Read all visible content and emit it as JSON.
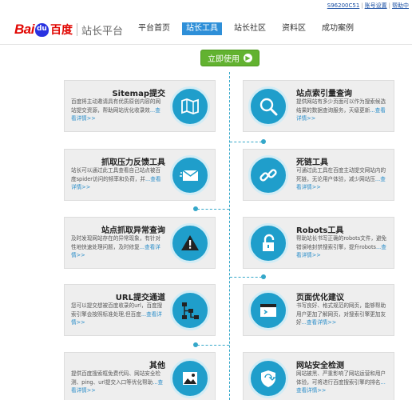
{
  "toplinks": {
    "user": "S96200C51",
    "account": "账号设置",
    "help": "帮助中"
  },
  "logo": {
    "bai": "Bai",
    "du": "百度",
    "site": "站长平台"
  },
  "nav": [
    "平台首页",
    "站长工具",
    "站长社区",
    "资料区",
    "成功案例"
  ],
  "start_button": "立即使用",
  "colors": {
    "accent": "#1f9ecb",
    "nav_active": "#2e8fd8",
    "button": "#62b230",
    "link": "#2a8ec9"
  },
  "cards": [
    {
      "title": "Sitemap提交",
      "desc": "百度将主动邀请具有优质原创内容的网站提交资源，帮助网站优化收录效",
      "more": "...查看详情>>",
      "icon": "map-icon"
    },
    {
      "title": "站点索引量查询",
      "desc": "提供网站有多少页面可以作为搜索候选结果的数据查询服务，天级更新",
      "more": "...查看详情>>",
      "icon": "search-icon"
    },
    {
      "title": "抓取压力反馈工具",
      "desc": "站长可以通过此工具查看自己站点被百度spider访问的频率和负荷，并",
      "more": "...查看详情>>",
      "icon": "mail-icon"
    },
    {
      "title": "死链工具",
      "desc": "可通过此工具在百度主动提交网站内的死链，无论用户体验，减少网站压",
      "more": "...查看详情>>",
      "icon": "broken-link-icon"
    },
    {
      "title": "站点抓取异常查询",
      "desc": "及时发现网站存在的异常现象，有针对性地快速处理问题，及时修复",
      "more": "...查看详情>>",
      "icon": "warning-icon"
    },
    {
      "title": "Robots工具",
      "desc": "帮助站长书写正确的robots文件，避免错误地封禁搜索引擎，提升robots",
      "more": "...查看详情>>",
      "icon": "unlock-icon"
    },
    {
      "title": "URL提交通道",
      "desc": "您可以提交想被百度收录的url，百度搜索引擎会按照标准处理,但百度",
      "more": "...查看详情>>",
      "icon": "sitemap-icon"
    },
    {
      "title": "页面优化建议",
      "desc": "书写良好、格式规范的网页，能够帮助用户更加了解网页，对搜索引擎更加友好",
      "more": "...查看详情>>",
      "icon": "browser-icon"
    },
    {
      "title": "其他",
      "desc": "提供百度搜索框免费代码、网站安全检测、ping、url提交入口等优化帮助",
      "more": "...查看详情>>",
      "icon": "image-icon"
    },
    {
      "title": "网站安全检测",
      "desc": "网站被黑、严重影响了网站运营和用户体验，可将进行百度搜索引擎的排名",
      "more": "...查看详情>>",
      "icon": "shield-icon"
    }
  ]
}
